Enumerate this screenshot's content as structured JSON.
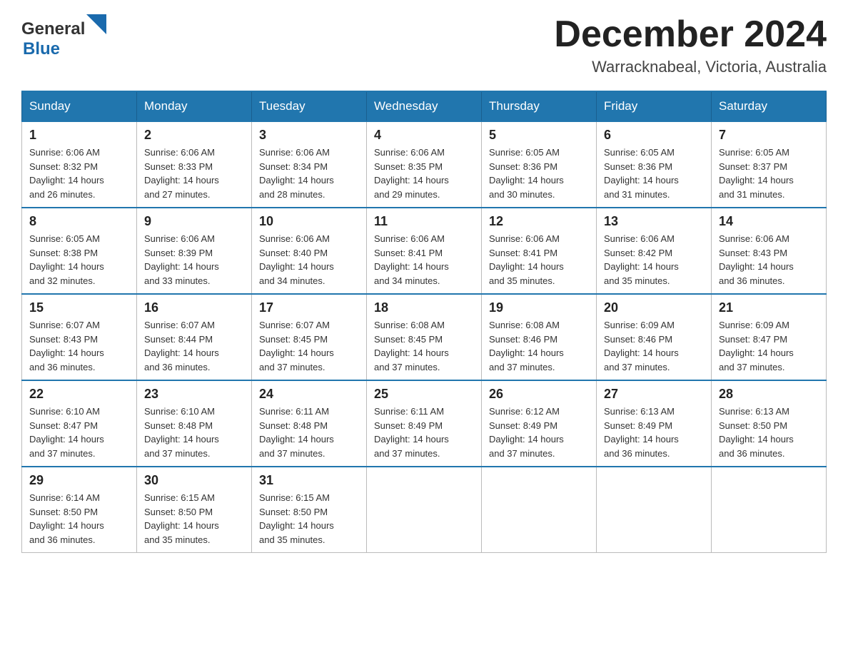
{
  "logo": {
    "general": "General",
    "blue": "Blue"
  },
  "title": {
    "month": "December 2024",
    "location": "Warracknabeal, Victoria, Australia"
  },
  "headers": [
    "Sunday",
    "Monday",
    "Tuesday",
    "Wednesday",
    "Thursday",
    "Friday",
    "Saturday"
  ],
  "weeks": [
    [
      {
        "day": "1",
        "sunrise": "6:06 AM",
        "sunset": "8:32 PM",
        "daylight": "14 hours and 26 minutes."
      },
      {
        "day": "2",
        "sunrise": "6:06 AM",
        "sunset": "8:33 PM",
        "daylight": "14 hours and 27 minutes."
      },
      {
        "day": "3",
        "sunrise": "6:06 AM",
        "sunset": "8:34 PM",
        "daylight": "14 hours and 28 minutes."
      },
      {
        "day": "4",
        "sunrise": "6:06 AM",
        "sunset": "8:35 PM",
        "daylight": "14 hours and 29 minutes."
      },
      {
        "day": "5",
        "sunrise": "6:05 AM",
        "sunset": "8:36 PM",
        "daylight": "14 hours and 30 minutes."
      },
      {
        "day": "6",
        "sunrise": "6:05 AM",
        "sunset": "8:36 PM",
        "daylight": "14 hours and 31 minutes."
      },
      {
        "day": "7",
        "sunrise": "6:05 AM",
        "sunset": "8:37 PM",
        "daylight": "14 hours and 31 minutes."
      }
    ],
    [
      {
        "day": "8",
        "sunrise": "6:05 AM",
        "sunset": "8:38 PM",
        "daylight": "14 hours and 32 minutes."
      },
      {
        "day": "9",
        "sunrise": "6:06 AM",
        "sunset": "8:39 PM",
        "daylight": "14 hours and 33 minutes."
      },
      {
        "day": "10",
        "sunrise": "6:06 AM",
        "sunset": "8:40 PM",
        "daylight": "14 hours and 34 minutes."
      },
      {
        "day": "11",
        "sunrise": "6:06 AM",
        "sunset": "8:41 PM",
        "daylight": "14 hours and 34 minutes."
      },
      {
        "day": "12",
        "sunrise": "6:06 AM",
        "sunset": "8:41 PM",
        "daylight": "14 hours and 35 minutes."
      },
      {
        "day": "13",
        "sunrise": "6:06 AM",
        "sunset": "8:42 PM",
        "daylight": "14 hours and 35 minutes."
      },
      {
        "day": "14",
        "sunrise": "6:06 AM",
        "sunset": "8:43 PM",
        "daylight": "14 hours and 36 minutes."
      }
    ],
    [
      {
        "day": "15",
        "sunrise": "6:07 AM",
        "sunset": "8:43 PM",
        "daylight": "14 hours and 36 minutes."
      },
      {
        "day": "16",
        "sunrise": "6:07 AM",
        "sunset": "8:44 PM",
        "daylight": "14 hours and 36 minutes."
      },
      {
        "day": "17",
        "sunrise": "6:07 AM",
        "sunset": "8:45 PM",
        "daylight": "14 hours and 37 minutes."
      },
      {
        "day": "18",
        "sunrise": "6:08 AM",
        "sunset": "8:45 PM",
        "daylight": "14 hours and 37 minutes."
      },
      {
        "day": "19",
        "sunrise": "6:08 AM",
        "sunset": "8:46 PM",
        "daylight": "14 hours and 37 minutes."
      },
      {
        "day": "20",
        "sunrise": "6:09 AM",
        "sunset": "8:46 PM",
        "daylight": "14 hours and 37 minutes."
      },
      {
        "day": "21",
        "sunrise": "6:09 AM",
        "sunset": "8:47 PM",
        "daylight": "14 hours and 37 minutes."
      }
    ],
    [
      {
        "day": "22",
        "sunrise": "6:10 AM",
        "sunset": "8:47 PM",
        "daylight": "14 hours and 37 minutes."
      },
      {
        "day": "23",
        "sunrise": "6:10 AM",
        "sunset": "8:48 PM",
        "daylight": "14 hours and 37 minutes."
      },
      {
        "day": "24",
        "sunrise": "6:11 AM",
        "sunset": "8:48 PM",
        "daylight": "14 hours and 37 minutes."
      },
      {
        "day": "25",
        "sunrise": "6:11 AM",
        "sunset": "8:49 PM",
        "daylight": "14 hours and 37 minutes."
      },
      {
        "day": "26",
        "sunrise": "6:12 AM",
        "sunset": "8:49 PM",
        "daylight": "14 hours and 37 minutes."
      },
      {
        "day": "27",
        "sunrise": "6:13 AM",
        "sunset": "8:49 PM",
        "daylight": "14 hours and 36 minutes."
      },
      {
        "day": "28",
        "sunrise": "6:13 AM",
        "sunset": "8:50 PM",
        "daylight": "14 hours and 36 minutes."
      }
    ],
    [
      {
        "day": "29",
        "sunrise": "6:14 AM",
        "sunset": "8:50 PM",
        "daylight": "14 hours and 36 minutes."
      },
      {
        "day": "30",
        "sunrise": "6:15 AM",
        "sunset": "8:50 PM",
        "daylight": "14 hours and 35 minutes."
      },
      {
        "day": "31",
        "sunrise": "6:15 AM",
        "sunset": "8:50 PM",
        "daylight": "14 hours and 35 minutes."
      },
      null,
      null,
      null,
      null
    ]
  ],
  "labels": {
    "sunrise": "Sunrise:",
    "sunset": "Sunset:",
    "daylight": "Daylight:"
  }
}
